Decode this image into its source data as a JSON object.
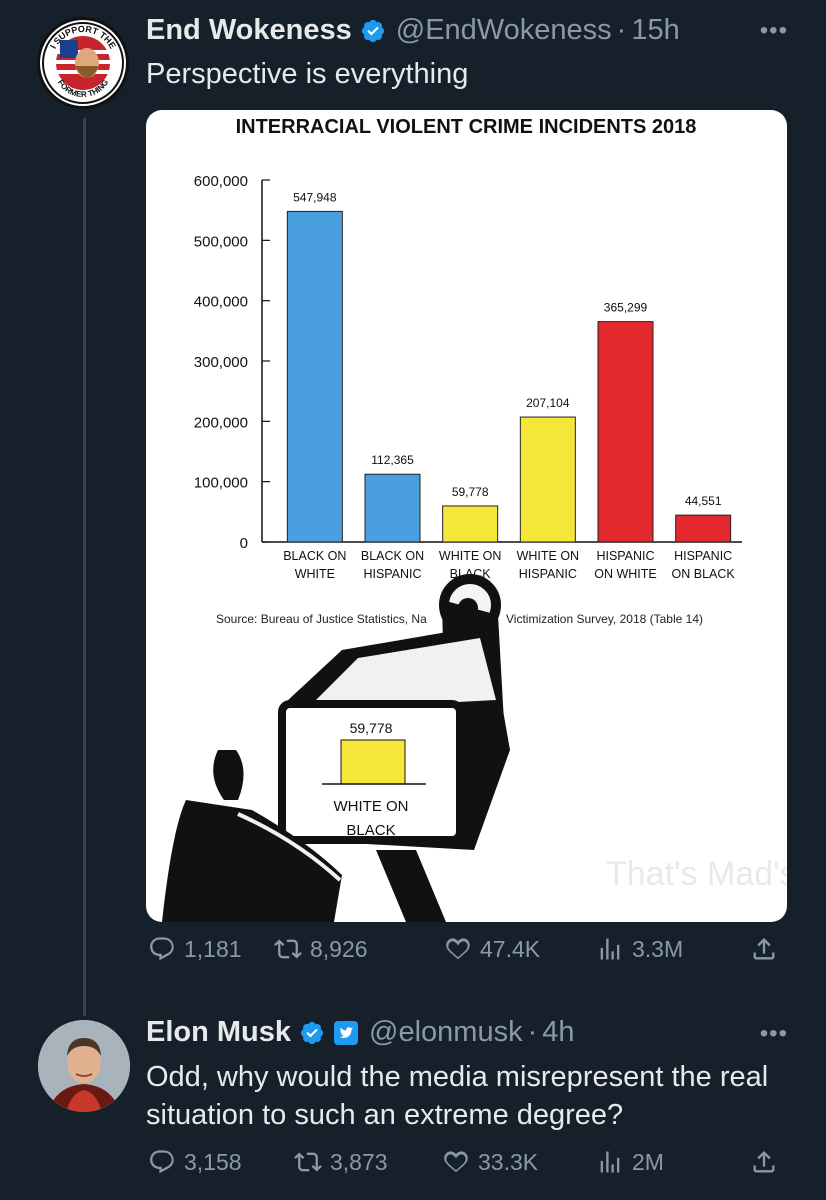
{
  "colors": {
    "background": "#15202b",
    "text": "#e7e9ea",
    "muted": "#8b98a5",
    "verified": "#1d9bf0",
    "bar_blue": "#4a9fe0",
    "bar_yellow": "#f6e63a",
    "bar_red": "#e3292e"
  },
  "tweets": [
    {
      "name": "End Wokeness",
      "handle": "@EndWokeness",
      "dot": "·",
      "time": "15h",
      "text": "Perspective is everything",
      "avatar_logo_text": [
        "I SUPPORT THE",
        "FORMER THING"
      ],
      "actions": {
        "replies": "1,181",
        "retweets": "8,926",
        "likes": "47.4K",
        "views": "3.3M"
      },
      "icons": [
        "verified-badge-icon",
        "more-icon",
        "reply-icon",
        "retweet-icon",
        "like-icon",
        "views-icon",
        "share-icon"
      ]
    },
    {
      "name": "Elon Musk",
      "handle": "@elonmusk",
      "dot": "·",
      "time": "4h",
      "text": "Odd, why would the media misrepresent the real situation to such an extreme degree?",
      "actions": {
        "replies": "3,158",
        "retweets": "3,873",
        "likes": "33.3K",
        "views": "2M"
      },
      "icons": [
        "verified-badge-icon",
        "twitter-affiliate-icon",
        "more-icon",
        "reply-icon",
        "retweet-icon",
        "like-icon",
        "views-icon",
        "share-icon"
      ]
    }
  ],
  "more_label": "•••",
  "media": {
    "meme_screen_value": "59,778",
    "meme_screen_label": [
      "WHITE ON",
      "BLACK"
    ],
    "watermark": "That's Mad's"
  },
  "chart_data": {
    "type": "bar",
    "title": "INTERRACIAL VIOLENT CRIME INCIDENTS 2018",
    "categories": [
      [
        "BLACK ON",
        "WHITE"
      ],
      [
        "BLACK ON",
        "HISPANIC"
      ],
      [
        "WHITE ON",
        "BLACK"
      ],
      [
        "WHITE ON",
        "HISPANIC"
      ],
      [
        "HISPANIC",
        "ON WHITE"
      ],
      [
        "HISPANIC",
        "ON BLACK"
      ]
    ],
    "values": [
      547948,
      112365,
      59778,
      207104,
      365299,
      44551
    ],
    "value_labels": [
      "547,948",
      "112,365",
      "59,778",
      "207,104",
      "365,299",
      "44,551"
    ],
    "bar_colors": [
      "#4a9fe0",
      "#4a9fe0",
      "#f6e63a",
      "#f6e63a",
      "#e3292e",
      "#e3292e"
    ],
    "ylim": [
      0,
      600000
    ],
    "yticks": [
      0,
      100000,
      200000,
      300000,
      400000,
      500000,
      600000
    ],
    "ytick_labels": [
      "0",
      "100,000",
      "200,000",
      "300,000",
      "400,000",
      "500,000",
      "600,000"
    ],
    "source_left": "Source: Bureau of Justice Statistics, Na",
    "source_right": "Victimization Survey, 2018 (Table 14)",
    "grid": false,
    "legend": "none"
  }
}
